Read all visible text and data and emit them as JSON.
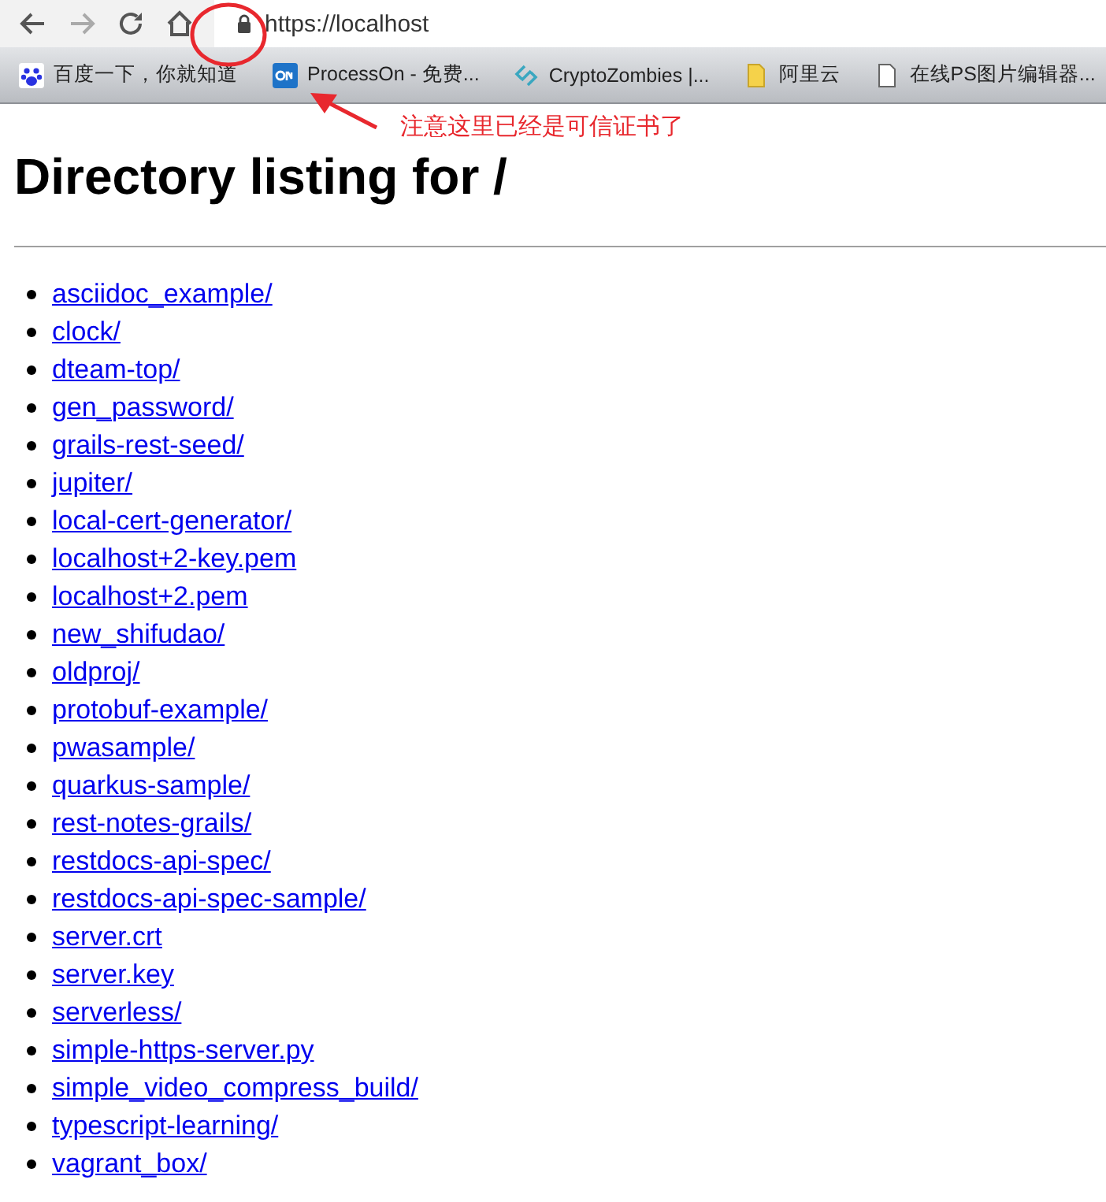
{
  "toolbar": {
    "address": "https://localhost"
  },
  "bookmarks": [
    {
      "label": "百度一下，你就知道",
      "kind": "paw"
    },
    {
      "label": "ProcessOn - 免费...",
      "kind": "on"
    },
    {
      "label": "CryptoZombies |...",
      "kind": "chain"
    },
    {
      "label": "阿里云",
      "kind": "folder"
    },
    {
      "label": "在线PS图片编辑器...",
      "kind": "page"
    }
  ],
  "annotation": {
    "text": "注意这里已经是可信证书了"
  },
  "heading": "Directory listing for /",
  "entries": [
    "asciidoc_example/",
    "clock/",
    "dteam-top/",
    "gen_password/",
    "grails-rest-seed/",
    "jupiter/",
    "local-cert-generator/",
    "localhost+2-key.pem",
    "localhost+2.pem",
    "new_shifudao/",
    "oldproj/",
    "protobuf-example/",
    "pwasample/",
    "quarkus-sample/",
    "rest-notes-grails/",
    "restdocs-api-spec/",
    "restdocs-api-spec-sample/",
    "server.crt",
    "server.key",
    "serverless/",
    "simple-https-server.py",
    "simple_video_compress_build/",
    "typescript-learning/",
    "vagrant_box/"
  ]
}
